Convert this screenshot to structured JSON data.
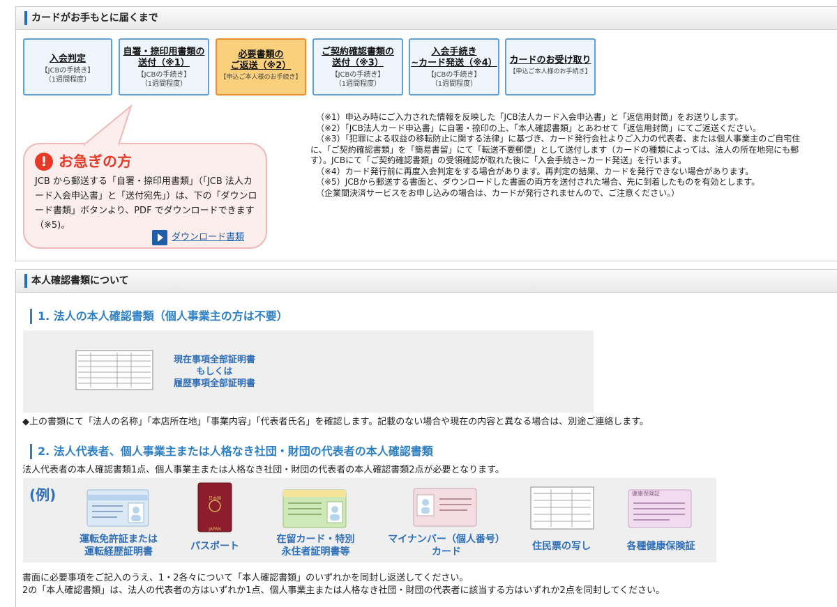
{
  "delivery": {
    "heading": "カードがお手もとに届くまで",
    "steps": [
      {
        "label": "入会判定",
        "sub": "【JCBの手続き】\n（1週間程度）"
      },
      {
        "label": "自署・捺印用書類の\n送付（※1）",
        "sub": "【JCBの手続き】\n（1週間程度）"
      },
      {
        "label": "必要書類の\nご返送（※2）",
        "sub": "【申込ご本人様のお手続き】"
      },
      {
        "label": "ご契約確認書類の\n送付（※3）",
        "sub": "【JCBの手続き】\n（1週間程度）"
      },
      {
        "label": "入会手続き\n~カード発送（※4）",
        "sub": "【JCBの手続き】\n（1週間程度）"
      },
      {
        "label": "カードのお受け取り",
        "sub": "【申込ご本人様のお手続き】"
      }
    ],
    "urgent": {
      "title": "お急ぎの方",
      "body": "JCB から郵送する「自署・捺印用書類」（「JCB 法人カード入会申込書」と「送付宛先」）は、下の「ダウンロード書類」ボタンより、PDF でダウンロードできます（※5)。",
      "download_label": "ダウンロード書類"
    },
    "notes": [
      "（※1）申込み時にご入力された情報を反映した「JCB法人カード入会申込書」と「返信用封筒」をお送りします。",
      "（※2）「JCB法人カード申込書」に自署・捺印の上、「本人確認書類」とあわせて「返信用封筒」にてご返送ください。",
      "（※3）「犯罪による収益の移転防止に関する法律」に基づき、カード発行会社よりご入力の代表者、または個人事業主のご自宅住",
      "に、「ご契約確認書類」を「簡易書留」にて「転送不要郵便」として送付します（カードの種類によっては、法人の所在地宛にも郵",
      "す）。JCBにて「ご契約確認書類」の受領確認が取れた後に「入会手続き~カード発送」を行います。",
      "（※4）カード発行前に再度入会判定をする場合があります。再判定の結果、カードを発行できない場合があります。",
      "（※5）JCBから郵送する書面と、ダウンロードした書面の両方を送付された場合、先に到着したものを有効とします。",
      "（企業間決済サービスをお申し込みの場合は、カードが発行されませんので、ご注意ください。）"
    ]
  },
  "identity": {
    "heading": "本人確認書類について",
    "section1": {
      "title": "1. 法人の本人確認書類（個人事業主の方は不要）",
      "doc_label": "現在事項全部証明書\nもしくは\n履歴事項全部証明書",
      "note": "◆上の書類にて「法人の名称」「本店所在地」「事業内容」「代表者氏名」を確認します。記載のない場合や現在の内容と異なる場合は、別途ご連絡します。"
    },
    "section2": {
      "title": "2. 法人代表者、個人事業主または人格なき社団・財団の代表者の本人確認書類",
      "intro": "法人代表者の本人確認書類1点、個人事業主または人格なき社団・財団の代表者の本人確認書類2点が必要となります。",
      "example_label": "(例)",
      "passport_text": "日本国\nJAPAN",
      "health_card_text": "健康保険証",
      "items": [
        {
          "label": "運転免許証または\n運転経歴証明書",
          "icon": "drivers-license-icon"
        },
        {
          "label": "パスポート",
          "icon": "passport-icon"
        },
        {
          "label": "在留カード・特別\n永住者証明書等",
          "icon": "residence-card-icon"
        },
        {
          "label": "マイナンバー（個人番号）\nカード",
          "icon": "my-number-card-icon"
        },
        {
          "label": "住民票の写し",
          "icon": "resident-record-icon"
        },
        {
          "label": "各種健康保険証",
          "icon": "health-insurance-card-icon"
        }
      ]
    },
    "footer": [
      "書面に必要事項をご記入のうえ、1・2各々について「本人確認書類」のいずれかを同封し返送してください。",
      "2の「本人確認書類」は、法人の代表者の方はいずれか1点、個人事業主または人格なき社団・財団の代表者に該当する方はいずれか2点を同封してください。"
    ]
  },
  "colors": {
    "accent_blue": "#2d7fc4",
    "step_border": "#5fa0d8",
    "active_step": "#fbd07c",
    "urgent_red": "#e53a28"
  }
}
